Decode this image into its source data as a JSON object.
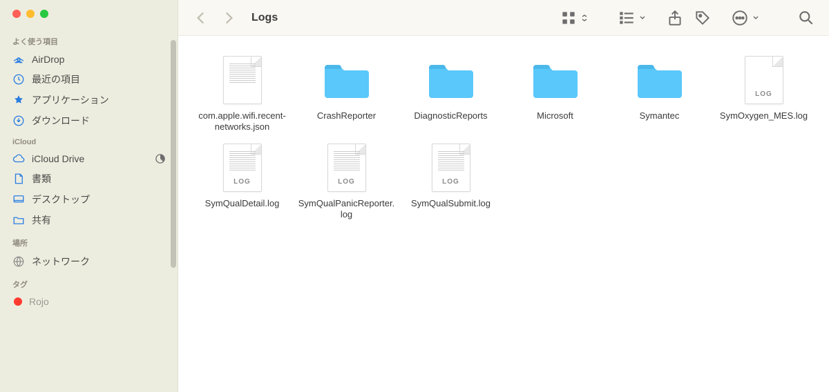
{
  "window": {
    "title": "Logs"
  },
  "sidebar": {
    "sections": [
      {
        "header": "よく使う項目",
        "items": [
          {
            "icon": "airdrop",
            "label": "AirDrop"
          },
          {
            "icon": "clock",
            "label": "最近の項目"
          },
          {
            "icon": "app",
            "label": "アプリケーション"
          },
          {
            "icon": "download",
            "label": "ダウンロード"
          }
        ]
      },
      {
        "header": "iCloud",
        "items": [
          {
            "icon": "cloud",
            "label": "iCloud Drive",
            "status": "pie"
          },
          {
            "icon": "doc",
            "label": "書類"
          },
          {
            "icon": "desktop",
            "label": "デスクトップ"
          },
          {
            "icon": "share",
            "label": "共有"
          }
        ]
      },
      {
        "header": "場所",
        "items": [
          {
            "icon": "globe",
            "label": "ネットワーク"
          }
        ]
      },
      {
        "header": "タグ",
        "items": [
          {
            "icon": "tag-red",
            "label": "Rojo"
          }
        ]
      }
    ]
  },
  "content": {
    "items": [
      {
        "type": "file",
        "subtype": "text",
        "name": "com.apple.wifi.recent-networks.json"
      },
      {
        "type": "folder",
        "name": "CrashReporter"
      },
      {
        "type": "folder",
        "name": "DiagnosticReports"
      },
      {
        "type": "folder",
        "name": "Microsoft"
      },
      {
        "type": "folder",
        "name": "Symantec"
      },
      {
        "type": "file",
        "subtype": "log",
        "name": "SymOxygen_MES.log"
      },
      {
        "type": "file",
        "subtype": "log-text",
        "name": "SymQualDetail.log"
      },
      {
        "type": "file",
        "subtype": "log-text",
        "name": "SymQualPanicReporter.log"
      },
      {
        "type": "file",
        "subtype": "log-text",
        "name": "SymQualSubmit.log"
      }
    ]
  },
  "labels": {
    "log": "LOG"
  }
}
